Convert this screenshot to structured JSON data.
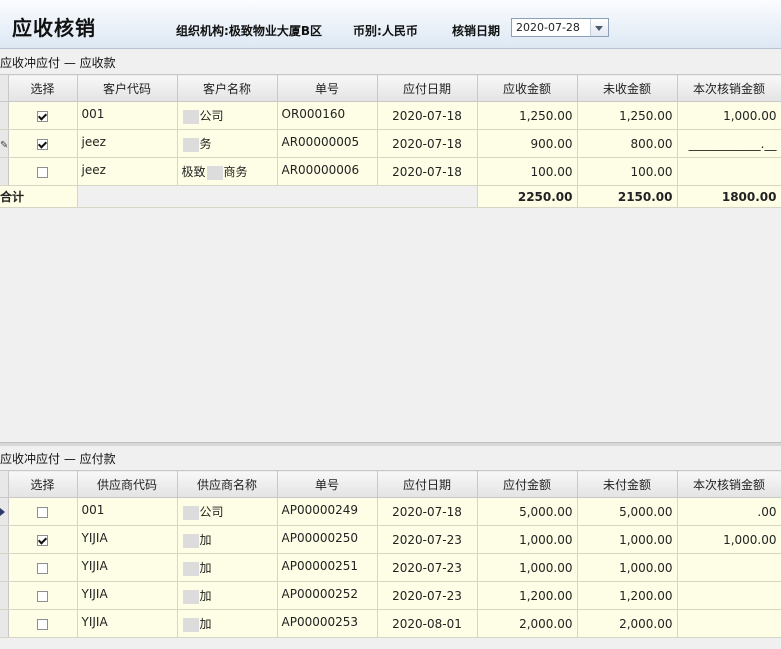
{
  "header": {
    "title": "应收核销",
    "org_label": "组织机构:",
    "org_value": "极致物业大厦B区",
    "currency_label": "币别:",
    "currency_value": "人民币",
    "date_label": "核销日期",
    "date_value": "2020-07-28"
  },
  "receivable": {
    "section_title": "应收冲应付 — 应收款",
    "columns": [
      "选择",
      "客户代码",
      "客户名称",
      "单号",
      "应付日期",
      "应收金额",
      "未收金额",
      "本次核销金额"
    ],
    "rows": [
      {
        "checked": true,
        "code": "001",
        "name_pre": "",
        "name_post": "公司",
        "no": "OR000160",
        "date": "2020-07-18",
        "amount": "1,250.00",
        "unpaid": "1,250.00",
        "writeoff": "1,000.00"
      },
      {
        "checked": true,
        "code": "jeez",
        "name_pre": "",
        "name_post": "务",
        "no": "AR00000005",
        "date": "2020-07-18",
        "amount": "900.00",
        "unpaid": "800.00",
        "writeoff": "____________.__"
      },
      {
        "checked": false,
        "code": "jeez",
        "name_pre": "极致",
        "name_post": "商务",
        "no": "AR00000006",
        "date": "2020-07-18",
        "amount": "100.00",
        "unpaid": "100.00",
        "writeoff": ""
      }
    ],
    "total": {
      "label": "合计",
      "amount": "2250.00",
      "unpaid": "2150.00",
      "writeoff": "1800.00"
    }
  },
  "payable": {
    "section_title": "应收冲应付 — 应付款",
    "columns": [
      "选择",
      "供应商代码",
      "供应商名称",
      "单号",
      "应付日期",
      "应付金额",
      "未付金额",
      "本次核销金额"
    ],
    "rows": [
      {
        "checked": false,
        "code": "001",
        "name_post": "公司",
        "no": "AP00000249",
        "date": "2020-07-18",
        "amount": "5,000.00",
        "unpaid": "5,000.00",
        "writeoff": ".00"
      },
      {
        "checked": true,
        "code": "YIJIA",
        "name_post": "加",
        "no": "AP00000250",
        "date": "2020-07-23",
        "amount": "1,000.00",
        "unpaid": "1,000.00",
        "writeoff": "1,000.00"
      },
      {
        "checked": false,
        "code": "YIJIA",
        "name_post": "加",
        "no": "AP00000251",
        "date": "2020-07-23",
        "amount": "1,000.00",
        "unpaid": "1,000.00",
        "writeoff": ""
      },
      {
        "checked": false,
        "code": "YIJIA",
        "name_post": "加",
        "no": "AP00000252",
        "date": "2020-07-23",
        "amount": "1,200.00",
        "unpaid": "1,200.00",
        "writeoff": ""
      },
      {
        "checked": false,
        "code": "YIJIA",
        "name_post": "加",
        "no": "AP00000253",
        "date": "2020-08-01",
        "amount": "2,000.00",
        "unpaid": "2,000.00",
        "writeoff": ""
      }
    ]
  }
}
